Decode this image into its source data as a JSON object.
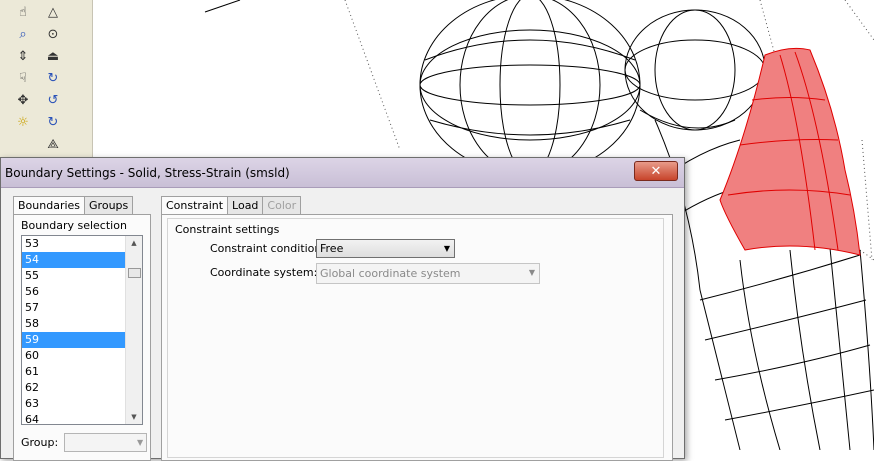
{
  "toolbar": {
    "col1": [
      "view-icon",
      "zoom-icon",
      "pan-icon",
      "select-icon",
      "mesh-select-icon",
      "light-icon"
    ],
    "col2": [
      "triangle-icon",
      "cylinder-icon",
      "plane-icon",
      "rotate-icon",
      "rotate-y-icon",
      "rotate-z-icon",
      "axes-icon",
      "delete-icon"
    ]
  },
  "dialog": {
    "title": "Boundary Settings - Solid, Stress-Strain (smsld)",
    "close_label": "✕",
    "left_tabs": [
      "Boundaries",
      "Groups"
    ],
    "boundary_selection_label": "Boundary selection",
    "boundaries": [
      {
        "label": "53",
        "selected": false
      },
      {
        "label": "54",
        "selected": true
      },
      {
        "label": "55",
        "selected": false
      },
      {
        "label": "56",
        "selected": false
      },
      {
        "label": "57",
        "selected": false
      },
      {
        "label": "58",
        "selected": false
      },
      {
        "label": "59",
        "selected": true
      },
      {
        "label": "60",
        "selected": false
      },
      {
        "label": "61",
        "selected": false
      },
      {
        "label": "62",
        "selected": false
      },
      {
        "label": "63",
        "selected": false
      },
      {
        "label": "64",
        "selected": false
      }
    ],
    "group_label": "Group:",
    "right_tabs": [
      "Constraint",
      "Load",
      "Color"
    ],
    "constraint_settings_label": "Constraint settings",
    "constraint_condition_label": "Constraint condition:",
    "constraint_condition_value": "Free",
    "coordinate_system_label": "Coordinate system:",
    "coordinate_system_value": "Global coordinate system"
  },
  "colors": {
    "selected_face": "#f08080",
    "selection_highlight": "#3399ff",
    "close_button": "#c7442b"
  }
}
